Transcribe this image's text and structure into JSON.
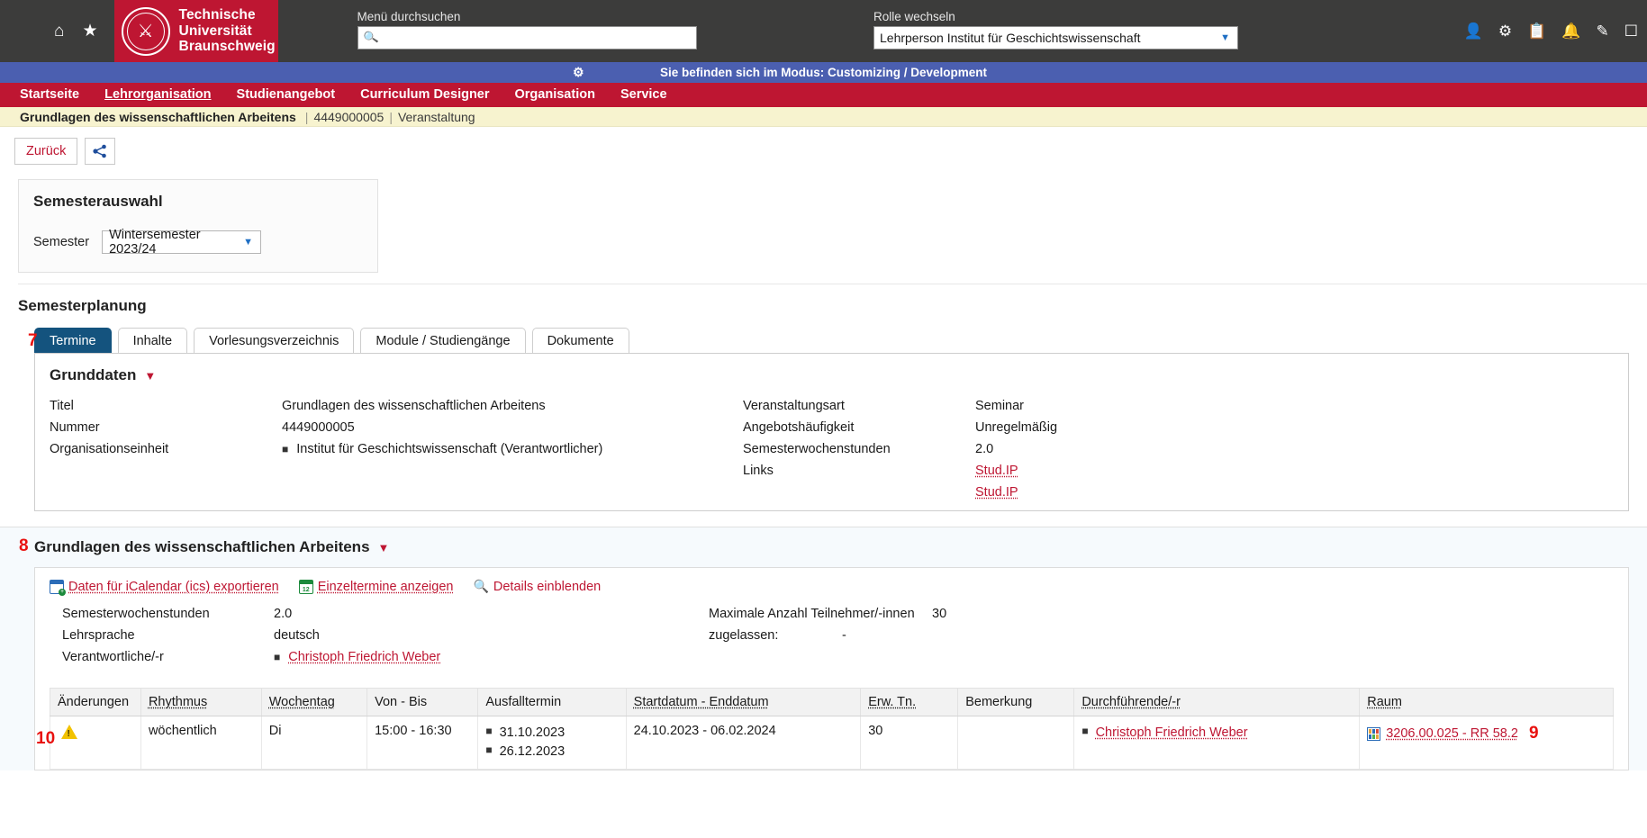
{
  "topbar": {
    "icons": [
      "menu-icon",
      "home-icon",
      "star-icon"
    ],
    "logo": {
      "line1": "Technische",
      "line2": "Universität",
      "line3": "Braunschweig"
    },
    "search": {
      "label": "Menü durchsuchen",
      "value": "",
      "placeholder": ""
    },
    "role": {
      "label": "Rolle wechseln",
      "value": "Lehrperson Institut für Geschichtswissenschaft"
    },
    "right_icons": [
      "user-icon",
      "gear-icon",
      "clipboard-icon",
      "bell-icon",
      "pencil-icon",
      "window-icon"
    ]
  },
  "mode_banner": {
    "text": "Sie befinden sich im Modus: Customizing / Development"
  },
  "mainnav": {
    "items": [
      {
        "label": "Startseite",
        "active": false
      },
      {
        "label": "Lehrorganisation",
        "active": true
      },
      {
        "label": "Studienangebot",
        "active": false
      },
      {
        "label": "Curriculum Designer",
        "active": false
      },
      {
        "label": "Organisation",
        "active": false
      },
      {
        "label": "Service",
        "active": false
      }
    ]
  },
  "breadcrumb": {
    "title": "Grundlagen des wissenschaftlichen Arbeitens",
    "number": "4449000005",
    "type": "Veranstaltung",
    "separator": "|"
  },
  "actions": {
    "back": "Zurück",
    "share_icon": "share-icon"
  },
  "semesterauswahl": {
    "title": "Semesterauswahl",
    "field_label": "Semester",
    "selected": "Wintersemester 2023/24"
  },
  "semesterplanung": {
    "title": "Semesterplanung",
    "annotation": "7",
    "tabs": [
      {
        "label": "Termine",
        "active": true
      },
      {
        "label": "Inhalte",
        "active": false
      },
      {
        "label": "Vorlesungsverzeichnis",
        "active": false
      },
      {
        "label": "Module / Studiengänge",
        "active": false
      },
      {
        "label": "Dokumente",
        "active": false
      }
    ]
  },
  "grunddaten": {
    "title": "Grunddaten",
    "left": [
      {
        "key": "Titel",
        "value": "Grundlagen des wissenschaftlichen Arbeitens",
        "bullet": false
      },
      {
        "key": "Nummer",
        "value": "4449000005",
        "bullet": false
      },
      {
        "key": "Organisationseinheit",
        "value": "Institut für Geschichtswissenschaft (Verantwortlicher)",
        "bullet": true
      }
    ],
    "right": [
      {
        "key": "Veranstaltungsart",
        "value": "Seminar"
      },
      {
        "key": "Angebotshäufigkeit",
        "value": "Unregelmäßig"
      },
      {
        "key": "Semesterwochenstunden",
        "value": "2.0"
      }
    ],
    "links_label": "Links",
    "links": [
      "Stud.IP",
      "Stud.IP"
    ]
  },
  "termin_section": {
    "annotation": "8",
    "title": "Grundlagen des wissenschaftlichen Arbeitens",
    "toolbar": [
      {
        "label": "Daten für iCalendar (ics) exportieren",
        "icon": "calendar-export-icon"
      },
      {
        "label": "Einzeltermine anzeigen",
        "icon": "calendar-days-icon"
      },
      {
        "label": "Details einblenden",
        "icon": "magnifier-icon"
      }
    ],
    "details_left": [
      {
        "key": "Semesterwochenstunden",
        "value": "2.0",
        "link": false
      },
      {
        "key": "Lehrsprache",
        "value": "deutsch",
        "link": false
      },
      {
        "key": "Verantwortliche/-r",
        "value": "Christoph Friedrich Weber",
        "link": true
      }
    ],
    "details_right": [
      {
        "key": "Maximale Anzahl Teilnehmer/-innen",
        "value": "30"
      },
      {
        "key": "zugelassen:",
        "value": "-"
      }
    ],
    "table": {
      "columns": [
        {
          "label": "Änderungen",
          "sortable": false
        },
        {
          "label": "Rhythmus",
          "sortable": true
        },
        {
          "label": "Wochentag",
          "sortable": true
        },
        {
          "label": "Von - Bis",
          "sortable": false
        },
        {
          "label": "Ausfalltermin",
          "sortable": false
        },
        {
          "label": "Startdatum - Enddatum",
          "sortable": true
        },
        {
          "label": "Erw. Tn.",
          "sortable": true
        },
        {
          "label": "Bemerkung",
          "sortable": false
        },
        {
          "label": "Durchführende/-r",
          "sortable": true
        },
        {
          "label": "Raum",
          "sortable": true
        }
      ],
      "rows": [
        {
          "annotation_left": "10",
          "changes_icon": "warning-icon",
          "rhythmus": "wöchentlich",
          "wochentag": "Di",
          "von_bis": "15:00 - 16:30",
          "ausfalltermine": [
            "31.10.2023",
            "26.12.2023"
          ],
          "start_end": "24.10.2023 - 06.02.2024",
          "erw_tn": "30",
          "bemerkung": "",
          "durchfuehrende": [
            "Christoph Friedrich Weber"
          ],
          "raum": "3206.00.025 - RR 58.2",
          "raum_icon": "room-icon",
          "annotation_right": "9"
        }
      ]
    }
  },
  "colors": {
    "brand_red": "#be1632",
    "topbar_dark": "#3c3c3b",
    "mode_blue": "#4b5fb0",
    "tab_active": "#14537e",
    "crumb_yellow": "#f7f3cf",
    "annotation_red": "#e8110f",
    "link_red": "#be1632"
  }
}
